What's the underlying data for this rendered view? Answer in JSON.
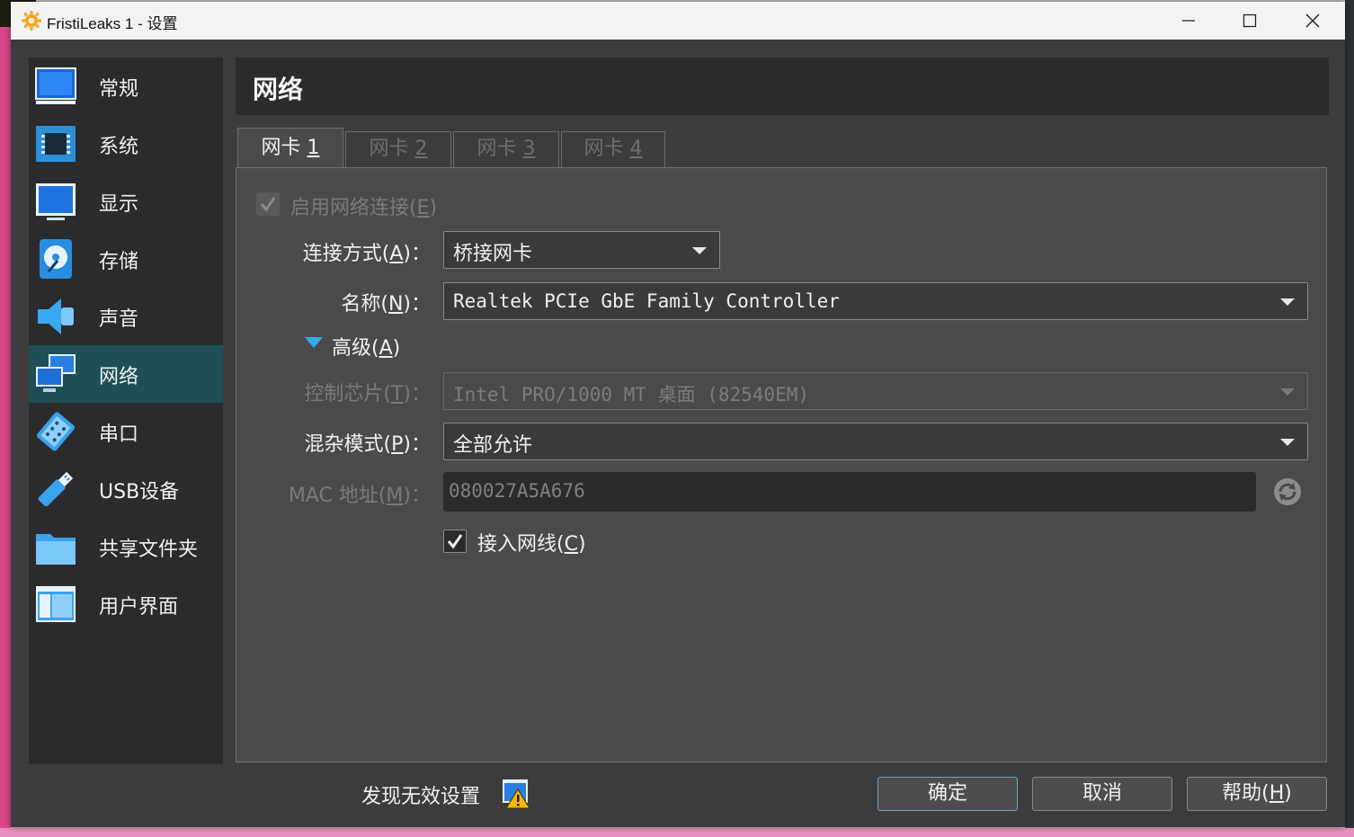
{
  "window": {
    "title": "FristiLeaks 1 - 设置"
  },
  "sidebar": {
    "items": [
      {
        "label": "常规",
        "icon": "monitor-icon"
      },
      {
        "label": "系统",
        "icon": "chip-icon"
      },
      {
        "label": "显示",
        "icon": "display-icon"
      },
      {
        "label": "存储",
        "icon": "storage-disk-icon"
      },
      {
        "label": "声音",
        "icon": "speaker-icon"
      },
      {
        "label": "网络",
        "icon": "network-icon"
      },
      {
        "label": "串口",
        "icon": "serial-port-icon"
      },
      {
        "label": "USB设备",
        "icon": "usb-icon"
      },
      {
        "label": "共享文件夹",
        "icon": "folder-icon"
      },
      {
        "label": "用户界面",
        "icon": "user-interface-icon"
      }
    ],
    "active_index": 5
  },
  "header": {
    "title": "网络"
  },
  "tabs": [
    {
      "label": "网卡 ",
      "key": "1"
    },
    {
      "label": "网卡 ",
      "key": "2"
    },
    {
      "label": "网卡 ",
      "key": "3"
    },
    {
      "label": "网卡 ",
      "key": "4"
    }
  ],
  "form": {
    "enable_adapter": {
      "label": "启用网络连接(",
      "key": "E",
      "end": ")"
    },
    "attached_to": {
      "label": "连接方式(",
      "key": "A",
      "end": ")：",
      "value": "桥接网卡"
    },
    "name": {
      "label": "名称(",
      "key": "N",
      "end": ")：",
      "value": "Realtek PCIe GbE Family Controller"
    },
    "advanced": {
      "label": "高级(",
      "key": "A",
      "end": ")"
    },
    "adapter_type": {
      "label": "控制芯片(",
      "key": "T",
      "end": ")：",
      "value": "Intel PRO/1000 MT 桌面 (82540EM)"
    },
    "promiscuous": {
      "label": "混杂模式(",
      "key": "P",
      "end": ")：",
      "value": "全部允许"
    },
    "mac": {
      "label": "MAC 地址(",
      "key": "M",
      "end": ")：",
      "value": "080027A5A676"
    },
    "cable": {
      "label": "接入网线(",
      "key": "C",
      "end": ")"
    }
  },
  "footer": {
    "warning_text": "发现无效设置",
    "ok": "确定",
    "cancel": "取消",
    "help": "帮助(",
    "help_key": "H",
    "help_end": ")"
  }
}
